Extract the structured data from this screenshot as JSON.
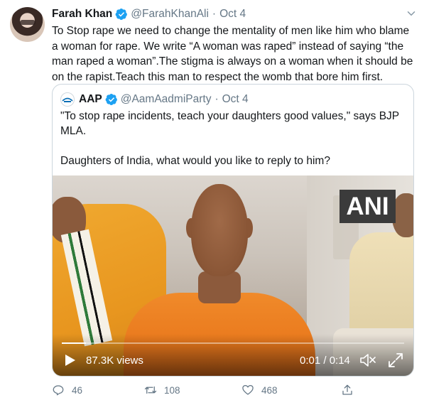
{
  "tweet": {
    "author_name": "Farah Khan",
    "author_handle": "@FarahKhanAli",
    "separator": "·",
    "date": "Oct 4",
    "text_lines": [
      "To Stop rape we need to change the mentality of men like him who blame",
      "a woman for rape. We write “A woman was raped” instead of saying “the",
      "man raped a woman”.The stigma is always on a woman when it should be",
      "on the rapist.Teach this man to respect the womb that bore him first."
    ]
  },
  "quoted_tweet": {
    "author_name": "AAP",
    "author_handle": "@AamAadmiParty",
    "separator": "·",
    "date": "Oct 4",
    "line1": "\"To stop rape incidents, teach your daughters good values,\" says BJP",
    "line2": "MLA.",
    "line3": "Daughters of India, what would you like to reply to him?"
  },
  "video": {
    "watermark": "ANI",
    "views": "87.3K views",
    "time": "0:01 / 0:14",
    "progress": 0.07
  },
  "actions": {
    "reply_count": "46",
    "retweet_count": "108",
    "like_count": "468"
  },
  "icons": {
    "verified": "verified-badge-icon",
    "caret": "chevron-down-icon",
    "play": "play-icon",
    "mute": "mute-icon",
    "expand": "expand-icon",
    "reply": "reply-icon",
    "retweet": "retweet-icon",
    "like": "heart-icon",
    "share": "share-icon"
  },
  "colors": {
    "verified": "#1da1f2",
    "muted_text": "#657786",
    "border": "#ccd6dd"
  }
}
